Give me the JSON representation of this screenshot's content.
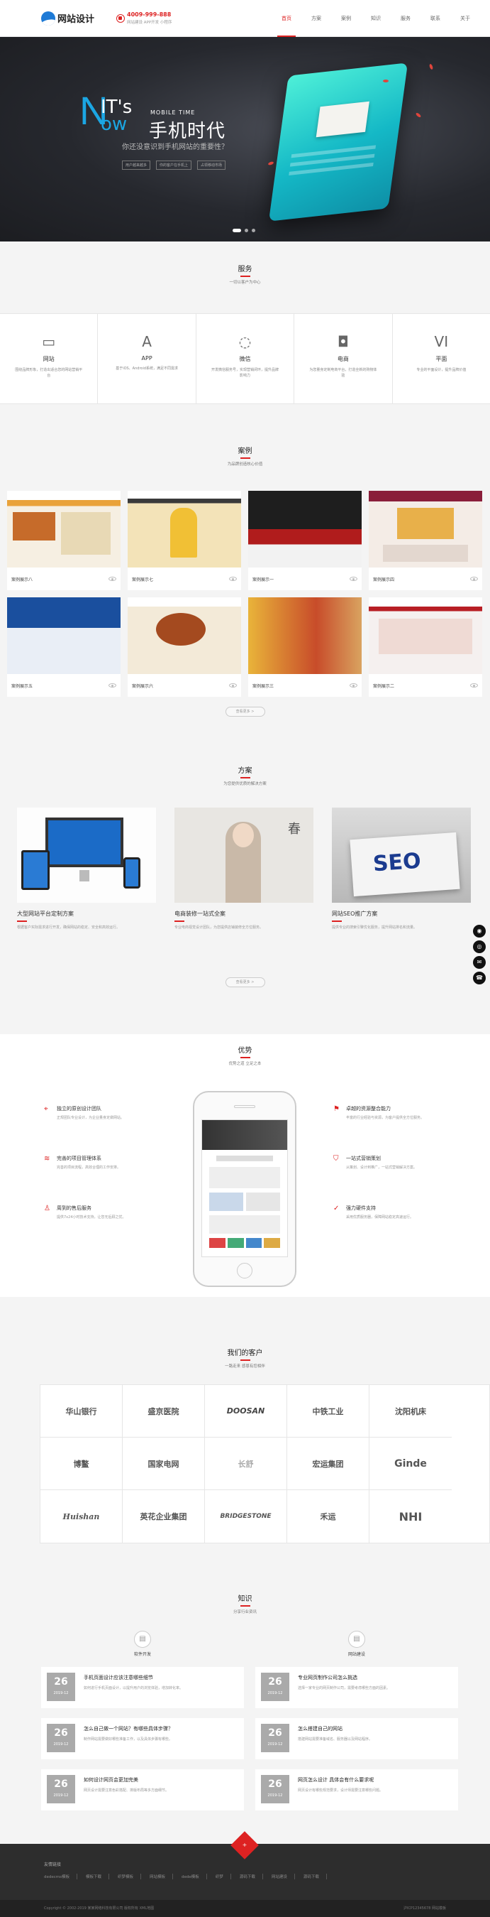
{
  "header": {
    "logo_text": "网站设计",
    "phone": "4009-999-888",
    "slogan": "网站建设 APP开发 小程序",
    "nav": [
      "首页",
      "方案",
      "案例",
      "知识",
      "服务",
      "联系",
      "关于"
    ]
  },
  "hero": {
    "n": "N",
    "its": "IT's",
    "ow": "ow",
    "mobile_time": "MOBILE TIME",
    "title": "手机时代",
    "subtitle": "你还没意识到手机网站的重要性？",
    "tags": [
      "用户越来越多",
      "你的客户在手机上",
      "占领移动市场"
    ]
  },
  "services": {
    "title": "服务",
    "subtitle": "一切以客户为中心",
    "items": [
      {
        "icon": "monitor-icon",
        "glyph": "▭",
        "name": "网站",
        "desc": "围绕品牌形象，打造出适合您的网站营销平台"
      },
      {
        "icon": "app-store-icon",
        "glyph": "A",
        "name": "APP",
        "desc": "基于iOS、Android系统，满足不同需求"
      },
      {
        "icon": "wechat-icon",
        "glyph": "◌",
        "name": "微信",
        "desc": "开发微信服务号，实现营销闭环，提升品牌影响力"
      },
      {
        "icon": "shopping-bag-icon",
        "glyph": "◘",
        "name": "电商",
        "desc": "为您量身定制电商平台，打造全新的购物体验"
      },
      {
        "icon": "vi-icon",
        "glyph": "VI",
        "name": "平面",
        "desc": "专业的平面设计，提升品牌价值"
      }
    ]
  },
  "cases": {
    "title": "案例",
    "subtitle": "为品牌创造核心价值",
    "items": [
      "案例展示八",
      "案例展示七",
      "案例展示一",
      "案例展示四",
      "案例展示五",
      "案例展示六",
      "案例展示三",
      "案例展示二"
    ],
    "more": "查看更多 >"
  },
  "solutions": {
    "title": "方案",
    "subtitle": "为您提供优质的解决方案",
    "items": [
      {
        "title": "大型网站平台定制方案",
        "desc": "根据客户实际需求进行开发，确保网站的稳定、安全和高效运行。"
      },
      {
        "title": "电商装修一站式全案",
        "desc": "专业电商视觉设计团队，为您提供店铺装修全方位服务。"
      },
      {
        "title": "网站SEO推广方案",
        "desc": "提供专业的搜索引擎优化服务，提升网站排名和流量。"
      }
    ],
    "seo_sign": "SEO",
    "more": "查看更多 >"
  },
  "advantages": {
    "title": "优势",
    "subtitle": "优势之道 立足之本",
    "left": [
      {
        "icon": "location-icon",
        "title": "独立的原创设计团队",
        "desc": "正规团队专业设计，为企业量身定做网站。"
      },
      {
        "icon": "layers-icon",
        "title": "完善的项目管理体系",
        "desc": "完善的项目流程，高效合理的工作安排。"
      },
      {
        "icon": "person-icon",
        "title": "周到的售后服务",
        "desc": "提供7x24小时技术支持，让您无后顾之忧。"
      }
    ],
    "right": [
      {
        "icon": "flag-icon",
        "title": "卓越的资源整合能力",
        "desc": "丰富的行业经验与资源，为客户提供全方位服务。"
      },
      {
        "icon": "shield-icon",
        "title": "一站式营销策划",
        "desc": "从策划、设计到推广，一站式营销解决方案。"
      },
      {
        "icon": "check-shield-icon",
        "title": "强力硬件支持",
        "desc": "采用优质服务器，保障网站稳定高速运行。"
      }
    ]
  },
  "clients": {
    "title": "我们的客户",
    "subtitle": "一路走来 感恩有您相伴",
    "logos": [
      "华山银行",
      "盛京医院",
      "DOOSAN",
      "中铁工业",
      "沈阳机床",
      "博鳌",
      "国家电网",
      "长舒",
      "宏运集团",
      "Ginde",
      "Huishan",
      "英花企业集团",
      "BRIDGESTONE",
      "禾运",
      "NHI"
    ]
  },
  "news": {
    "title": "知识",
    "subtitle": "分享行业资讯",
    "cat_left": "软件开发",
    "cat_right": "网站建设",
    "left": [
      {
        "day": "26",
        "ym": "2019-12",
        "title": "手机页面设计应该注意哪些细节",
        "desc": "如何进行手机页面设计，以提升用户的浏览体验，增加转化率。"
      },
      {
        "day": "26",
        "ym": "2019-12",
        "title": "怎么自己做一个网站？有哪些具体步骤？",
        "desc": "制作网站需要做好哪些准备工作，以及具体步骤有哪些。"
      },
      {
        "day": "26",
        "ym": "2019-12",
        "title": "如何设计网页会更加完美",
        "desc": "网页设计需要注意色彩搭配、排版布局等多方面细节。"
      }
    ],
    "right": [
      {
        "day": "26",
        "ym": "2019-12",
        "title": "专业网页制作公司怎么挑选",
        "desc": "选择一家专业的网页制作公司，需要考虑哪些方面的因素。"
      },
      {
        "day": "26",
        "ym": "2019-12",
        "title": "怎么搭建自己的网站",
        "desc": "搭建网站需要准备域名、服务器以及网站程序。"
      },
      {
        "day": "26",
        "ym": "2019-12",
        "title": "网页怎么设计 具体会有什么要求呢",
        "desc": "网页设计有哪些规范要求，设计师需要注意哪些问题。"
      }
    ]
  },
  "footer": {
    "badge": "+",
    "links_title": "友情链接",
    "links": [
      "dedecms模板",
      "模板下载",
      "织梦模板",
      "网站模板",
      "dede模板",
      "织梦",
      "源码下载",
      "网站建设",
      "源码下载"
    ],
    "copyright": "Copyright © 2002-2019 某某网络科技有限公司 版权所有  XML地图",
    "icp": "沪ICP12345678  网站模板"
  },
  "side": [
    "◉",
    "◎",
    "✉",
    "☎"
  ],
  "colors": {
    "accent": "#dd2222",
    "hero_blue": "#1ba6e3",
    "teal": "#14b8c6"
  }
}
